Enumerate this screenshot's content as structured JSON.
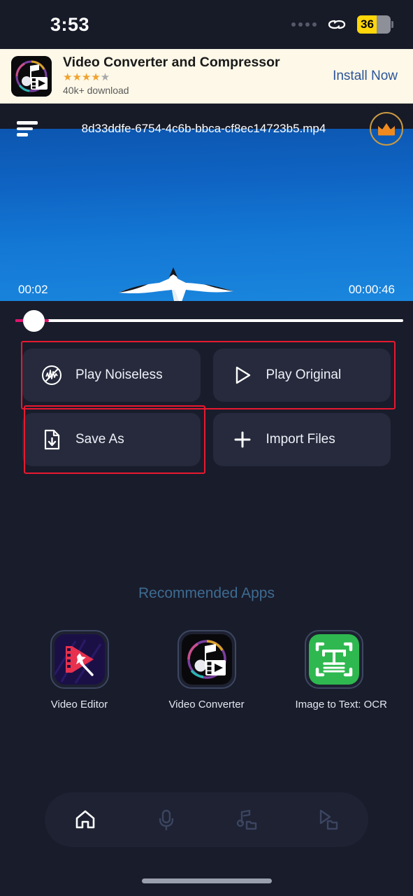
{
  "status_bar": {
    "time": "3:53",
    "battery_level": "36",
    "icons": [
      "signal-dots-icon",
      "link-chain-icon",
      "battery-icon"
    ],
    "battery_color": "#ffd60a"
  },
  "ad_banner": {
    "icon": "video-converter-app-icon",
    "title": "Video Converter and Compressor",
    "stars": "★★★★",
    "half_star": "★",
    "downloads": "40k+ download",
    "cta": "Install Now",
    "cta_color": "#2a5499",
    "background": "#fdf8e8"
  },
  "player": {
    "menu_icon": "hamburger-menu-icon",
    "file_name": "8d33ddfe-6754-4c6b-bbca-cf8ec14723b5.mp4",
    "premium_icon": "crown-icon",
    "premium_color": "#f08a1e",
    "current_time": "00:02",
    "duration": "00:00:46",
    "video_content": "bird-flying-in-blue-sky",
    "progress_percent": 8,
    "progress_color": "#e0136a"
  },
  "actions": {
    "row1": [
      {
        "label": "Play Noiseless",
        "icon": "noise-cancel-waveform-icon"
      },
      {
        "label": "Play Original",
        "icon": "play-triangle-icon"
      }
    ],
    "row2": [
      {
        "label": "Save As",
        "icon": "file-download-icon"
      },
      {
        "label": "Import Files",
        "icon": "plus-icon"
      }
    ],
    "highlight_color": "#e8192f"
  },
  "recommended": {
    "title": "Recommended Apps",
    "title_color": "#3e6b91",
    "apps": [
      {
        "label": "Video Editor",
        "icon": "video-editor-app-icon"
      },
      {
        "label": "Video Converter",
        "icon": "video-converter-app-icon"
      },
      {
        "label": "Image to Text: OCR",
        "icon": "ocr-app-icon"
      }
    ]
  },
  "bottom_nav": {
    "items": [
      {
        "name": "home",
        "icon": "home-icon",
        "active": true
      },
      {
        "name": "recorder",
        "icon": "microphone-icon",
        "active": false
      },
      {
        "name": "audio-files",
        "icon": "music-folder-icon",
        "active": false
      },
      {
        "name": "video-files",
        "icon": "video-folder-icon",
        "active": false
      }
    ]
  }
}
